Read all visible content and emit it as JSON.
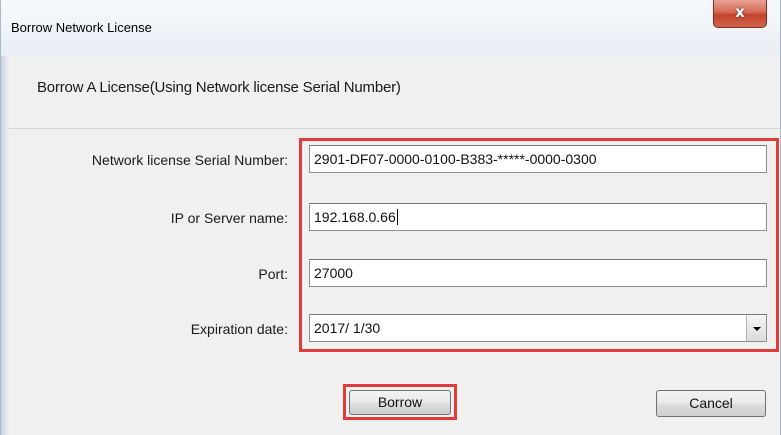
{
  "window": {
    "title": "Borrow Network License",
    "close_label": "x"
  },
  "heading": "Borrow A License(Using Network license Serial Number)",
  "form": {
    "serial": {
      "label": "Network license Serial Number:",
      "value": "2901-DF07-0000-0100-B383-*****-0000-0300"
    },
    "server": {
      "label": "IP or Server name:",
      "value": "192.168.0.66"
    },
    "port": {
      "label": "Port:",
      "value": "27000"
    },
    "expiration": {
      "label": "Expiration date:",
      "value": "2017/ 1/30"
    }
  },
  "buttons": {
    "borrow": "Borrow",
    "cancel": "Cancel"
  },
  "colors": {
    "highlight": "#e03c3c",
    "dialog_background": "#f0f0f0"
  }
}
